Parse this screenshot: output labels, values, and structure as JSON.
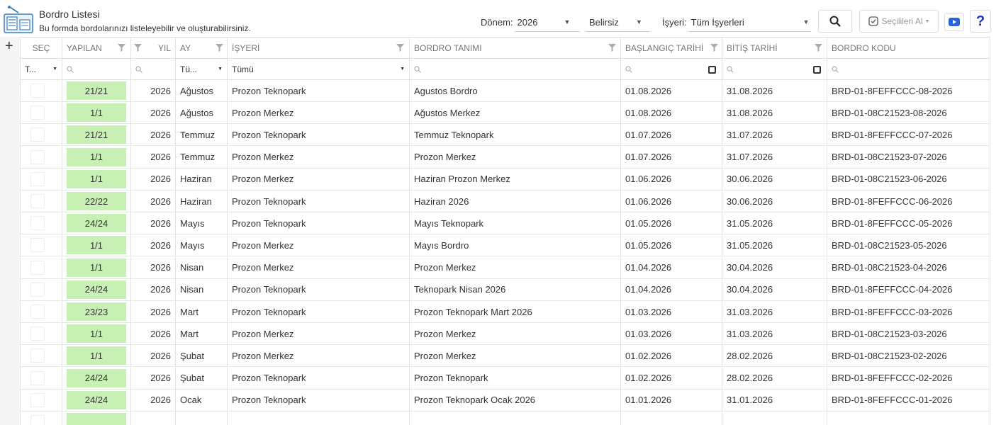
{
  "header": {
    "title": "Bordro Listesi",
    "subtitle": "Bu formda bordolarınızı listeleyebilir ve oluşturabilirsiniz.",
    "donem_label": "Dönem:",
    "donem_value": "2026",
    "belirsiz_value": "Belirsiz",
    "isyeri_label": "İşyeri:",
    "isyeri_value": "Tüm İşyerleri",
    "secilenleri_al_label": "Seçilileri Al",
    "help_label": "?"
  },
  "columns": {
    "sec": "SEÇ",
    "yapilan": "YAPILAN",
    "yil": "YIL",
    "ay": "AY",
    "isyeri": "İŞYERİ",
    "bordro_tanimi": "BORDRO TANIMI",
    "baslangic": "BAŞLANGIÇ TARİHİ",
    "bitis": "BİTİŞ TARİHİ",
    "bordro_kodu": "BORDRO KODU"
  },
  "filters": {
    "sec": "T...",
    "ay": "Tü...",
    "isyeri": "Tümü"
  },
  "rows": [
    {
      "yapilan": "21/21",
      "yil": "2026",
      "ay": "Ağustos",
      "isyeri": "Prozon Teknopark",
      "tanim": "Agustos Bordro",
      "bas": "01.08.2026",
      "bit": "31.08.2026",
      "kod": "BRD-01-8FEFFCCC-08-2026"
    },
    {
      "yapilan": "1/1",
      "yil": "2026",
      "ay": "Ağustos",
      "isyeri": "Prozon Merkez",
      "tanim": "Ağustos Merkez",
      "bas": "01.08.2026",
      "bit": "31.08.2026",
      "kod": "BRD-01-08C21523-08-2026"
    },
    {
      "yapilan": "21/21",
      "yil": "2026",
      "ay": "Temmuz",
      "isyeri": "Prozon Teknopark",
      "tanim": "Temmuz Teknopark",
      "bas": "01.07.2026",
      "bit": "31.07.2026",
      "kod": "BRD-01-8FEFFCCC-07-2026"
    },
    {
      "yapilan": "1/1",
      "yil": "2026",
      "ay": "Temmuz",
      "isyeri": "Prozon Merkez",
      "tanim": "Prozon Merkez",
      "bas": "01.07.2026",
      "bit": "31.07.2026",
      "kod": "BRD-01-08C21523-07-2026"
    },
    {
      "yapilan": "1/1",
      "yil": "2026",
      "ay": "Haziran",
      "isyeri": "Prozon Merkez",
      "tanim": "Haziran Prozon Merkez",
      "bas": "01.06.2026",
      "bit": "30.06.2026",
      "kod": "BRD-01-08C21523-06-2026"
    },
    {
      "yapilan": "22/22",
      "yil": "2026",
      "ay": "Haziran",
      "isyeri": "Prozon Teknopark",
      "tanim": "Haziran 2026",
      "bas": "01.06.2026",
      "bit": "30.06.2026",
      "kod": "BRD-01-8FEFFCCC-06-2026"
    },
    {
      "yapilan": "24/24",
      "yil": "2026",
      "ay": "Mayıs",
      "isyeri": "Prozon Teknopark",
      "tanim": "Mayıs Teknopark",
      "bas": "01.05.2026",
      "bit": "31.05.2026",
      "kod": "BRD-01-8FEFFCCC-05-2026"
    },
    {
      "yapilan": "1/1",
      "yil": "2026",
      "ay": "Mayıs",
      "isyeri": "Prozon Merkez",
      "tanim": "Mayıs Bordro",
      "bas": "01.05.2026",
      "bit": "31.05.2026",
      "kod": "BRD-01-08C21523-05-2026"
    },
    {
      "yapilan": "1/1",
      "yil": "2026",
      "ay": "Nisan",
      "isyeri": "Prozon Merkez",
      "tanim": "Prozon Merkez",
      "bas": "01.04.2026",
      "bit": "30.04.2026",
      "kod": "BRD-01-08C21523-04-2026"
    },
    {
      "yapilan": "24/24",
      "yil": "2026",
      "ay": "Nisan",
      "isyeri": "Prozon Teknopark",
      "tanim": "Teknopark Nisan 2026",
      "bas": "01.04.2026",
      "bit": "30.04.2026",
      "kod": "BRD-01-8FEFFCCC-04-2026"
    },
    {
      "yapilan": "23/23",
      "yil": "2026",
      "ay": "Mart",
      "isyeri": "Prozon Teknopark",
      "tanim": "Prozon Teknopark Mart 2026",
      "bas": "01.03.2026",
      "bit": "31.03.2026",
      "kod": "BRD-01-8FEFFCCC-03-2026"
    },
    {
      "yapilan": "1/1",
      "yil": "2026",
      "ay": "Mart",
      "isyeri": "Prozon Merkez",
      "tanim": "Prozon Merkez",
      "bas": "01.03.2026",
      "bit": "31.03.2026",
      "kod": "BRD-01-08C21523-03-2026"
    },
    {
      "yapilan": "1/1",
      "yil": "2026",
      "ay": "Şubat",
      "isyeri": "Prozon Merkez",
      "tanim": "Prozon Merkez",
      "bas": "01.02.2026",
      "bit": "28.02.2026",
      "kod": "BRD-01-08C21523-02-2026"
    },
    {
      "yapilan": "24/24",
      "yil": "2026",
      "ay": "Şubat",
      "isyeri": "Prozon Teknopark",
      "tanim": "Prozon Teknopark",
      "bas": "01.02.2026",
      "bit": "28.02.2026",
      "kod": "BRD-01-8FEFFCCC-02-2026"
    },
    {
      "yapilan": "24/24",
      "yil": "2026",
      "ay": "Ocak",
      "isyeri": "Prozon Teknopark",
      "tanim": "Prozon Teknopark Ocak 2026",
      "bas": "01.01.2026",
      "bit": "31.01.2026",
      "kod": "BRD-01-8FEFFCCC-01-2026"
    },
    {
      "yapilan": "",
      "yil": "",
      "ay": "",
      "isyeri": "",
      "tanim": "",
      "bas": "",
      "bit": "",
      "kod": ""
    }
  ],
  "colors": {
    "done_badge": "#c8f0b4",
    "help_icon": "#1b2fd4",
    "youtube_icon": "#2a64d8"
  }
}
